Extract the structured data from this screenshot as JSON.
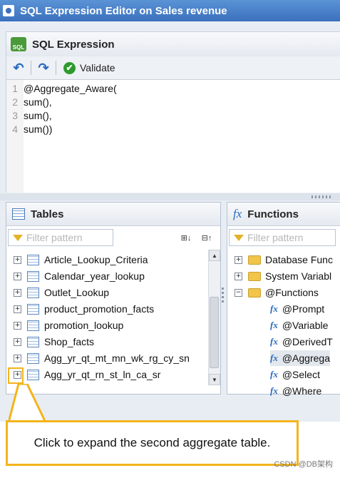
{
  "window": {
    "title": "SQL Expression Editor on Sales revenue"
  },
  "sql_panel": {
    "title": "SQL Expression",
    "validate_label": "Validate",
    "code_lines": [
      {
        "num": "1",
        "text": "@Aggregate_Aware("
      },
      {
        "num": "2",
        "text": "sum(),"
      },
      {
        "num": "3",
        "text": "sum(),"
      },
      {
        "num": "4",
        "text": "sum())"
      }
    ]
  },
  "tables_panel": {
    "title": "Tables",
    "filter_placeholder": "Filter pattern",
    "items": [
      "Article_Lookup_Criteria",
      "Calendar_year_lookup",
      "Outlet_Lookup",
      "product_promotion_facts",
      "promotion_lookup",
      "Shop_facts",
      "Agg_yr_qt_mt_mn_wk_rg_cy_sn",
      "Agg_yr_qt_rn_st_ln_ca_sr"
    ]
  },
  "functions_panel": {
    "title": "Functions",
    "filter_placeholder": "Filter pattern",
    "folders": [
      "Database Func",
      "System Variabl",
      "@Functions"
    ],
    "functions": [
      "@Prompt",
      "@Variable",
      "@DerivedT",
      "@Aggrega",
      "@Select",
      "@Where"
    ]
  },
  "callout": {
    "text": "Click to expand the second aggregate table."
  },
  "watermark": "CSDN @DB架构",
  "colors": {
    "title_bar": "#3a70bd",
    "callout_border": "#f4b41a"
  }
}
